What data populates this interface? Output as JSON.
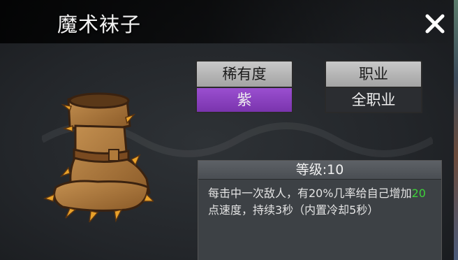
{
  "window": {
    "title": "魔术袜子"
  },
  "rarity": {
    "label": "稀有度",
    "value": "紫",
    "color": "#8e44c8"
  },
  "class": {
    "label": "职业",
    "value": "全职业"
  },
  "item": {
    "icon": "leather-boot-icon"
  },
  "level": {
    "label": "等级:10"
  },
  "description": {
    "part1": "每击中一次敌人，有20%几率给自己增加",
    "highlight": "20",
    "part2": "点速度，持续3秒（内置冷却5秒）",
    "highlight_color": "#3ed13a"
  }
}
